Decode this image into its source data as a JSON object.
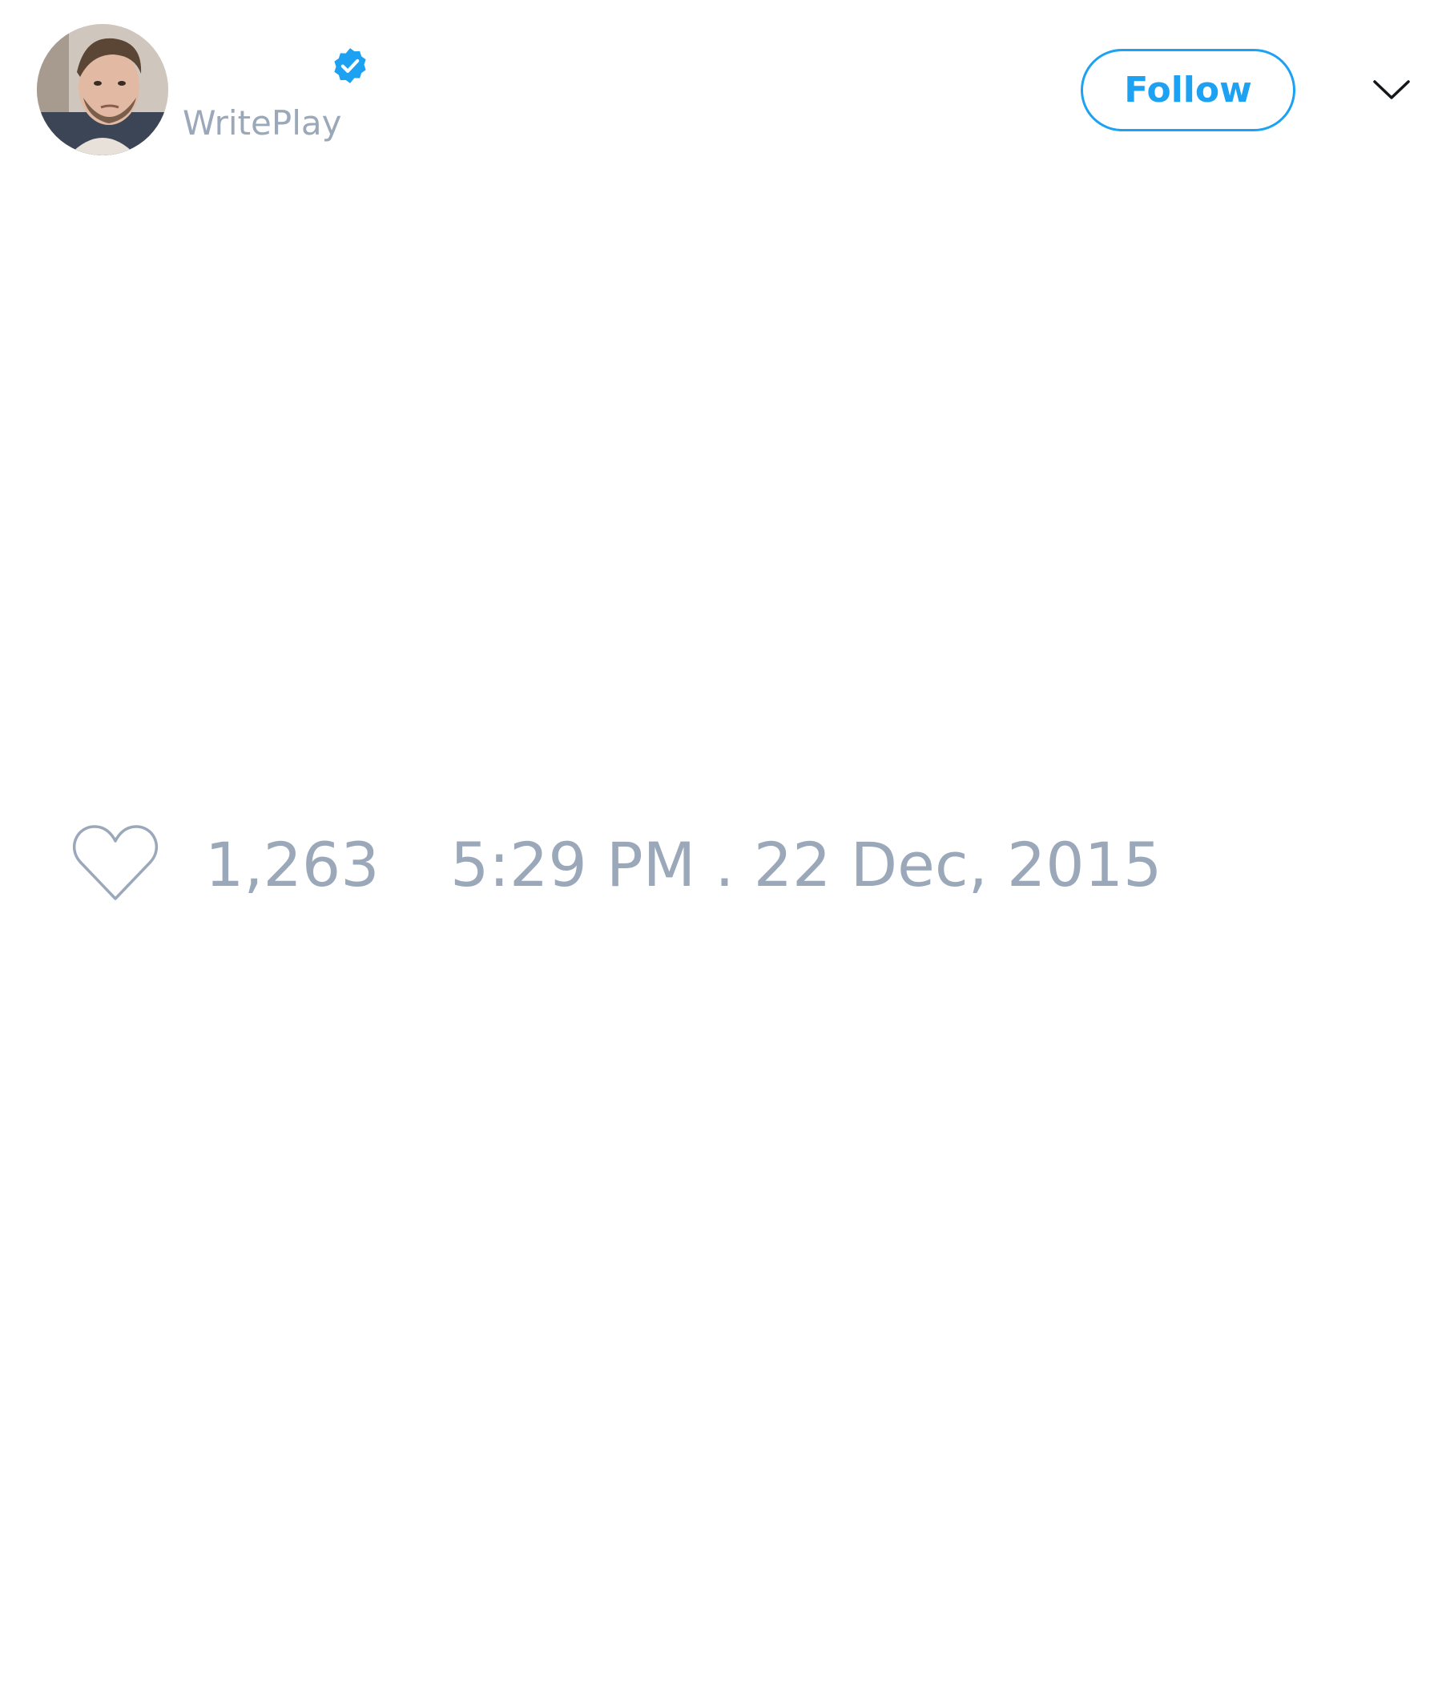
{
  "author": {
    "handle": "WritePlay",
    "verified": true,
    "avatar_icon": "user-avatar-photo",
    "verified_icon": "verified-badge-icon"
  },
  "actions": {
    "follow_label": "Follow",
    "menu_icon": "chevron-down-icon"
  },
  "stats": {
    "like_icon": "heart-outline-icon",
    "like_count": "1,263",
    "timestamp": "5:29 PM . 22 Dec, 2015"
  },
  "colors": {
    "accent": "#1da1f2",
    "muted_text": "#9aa8ba",
    "background": "#ffffff"
  }
}
